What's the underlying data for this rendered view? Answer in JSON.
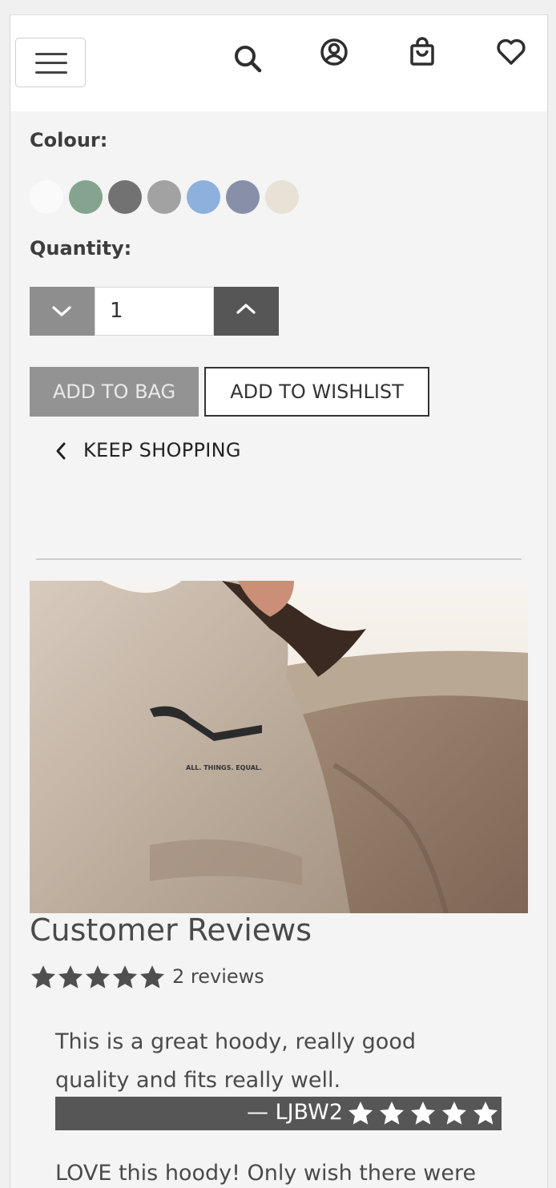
{
  "header": {
    "icons": [
      "menu-icon",
      "search-icon",
      "account-icon",
      "bag-icon",
      "heart-icon"
    ]
  },
  "product": {
    "colour_label": "Colour:",
    "swatch_colors": [
      "#fafafa",
      "#84a48f",
      "#727272",
      "#a2a2a2",
      "#8eb0dc",
      "#8790a8",
      "#e7e1d6"
    ],
    "quantity_label": "Quantity:",
    "quantity_value": "1",
    "add_to_bag": "ADD TO BAG",
    "add_to_wishlist": "ADD TO WISHLIST",
    "keep_shopping": "KEEP SHOPPING"
  },
  "reviews": {
    "title": "Customer Reviews",
    "average_rating": 5,
    "count_text": "2 reviews",
    "items": [
      {
        "text": "This is a great hoody, really good quality and fits really well.",
        "author": "— LJBW2",
        "rating": 5
      },
      {
        "text": "LOVE this hoody! Only wish there were"
      }
    ]
  },
  "colors": {
    "accent": "#565656",
    "disabled": "#939393",
    "background": "#f4f4f4"
  }
}
